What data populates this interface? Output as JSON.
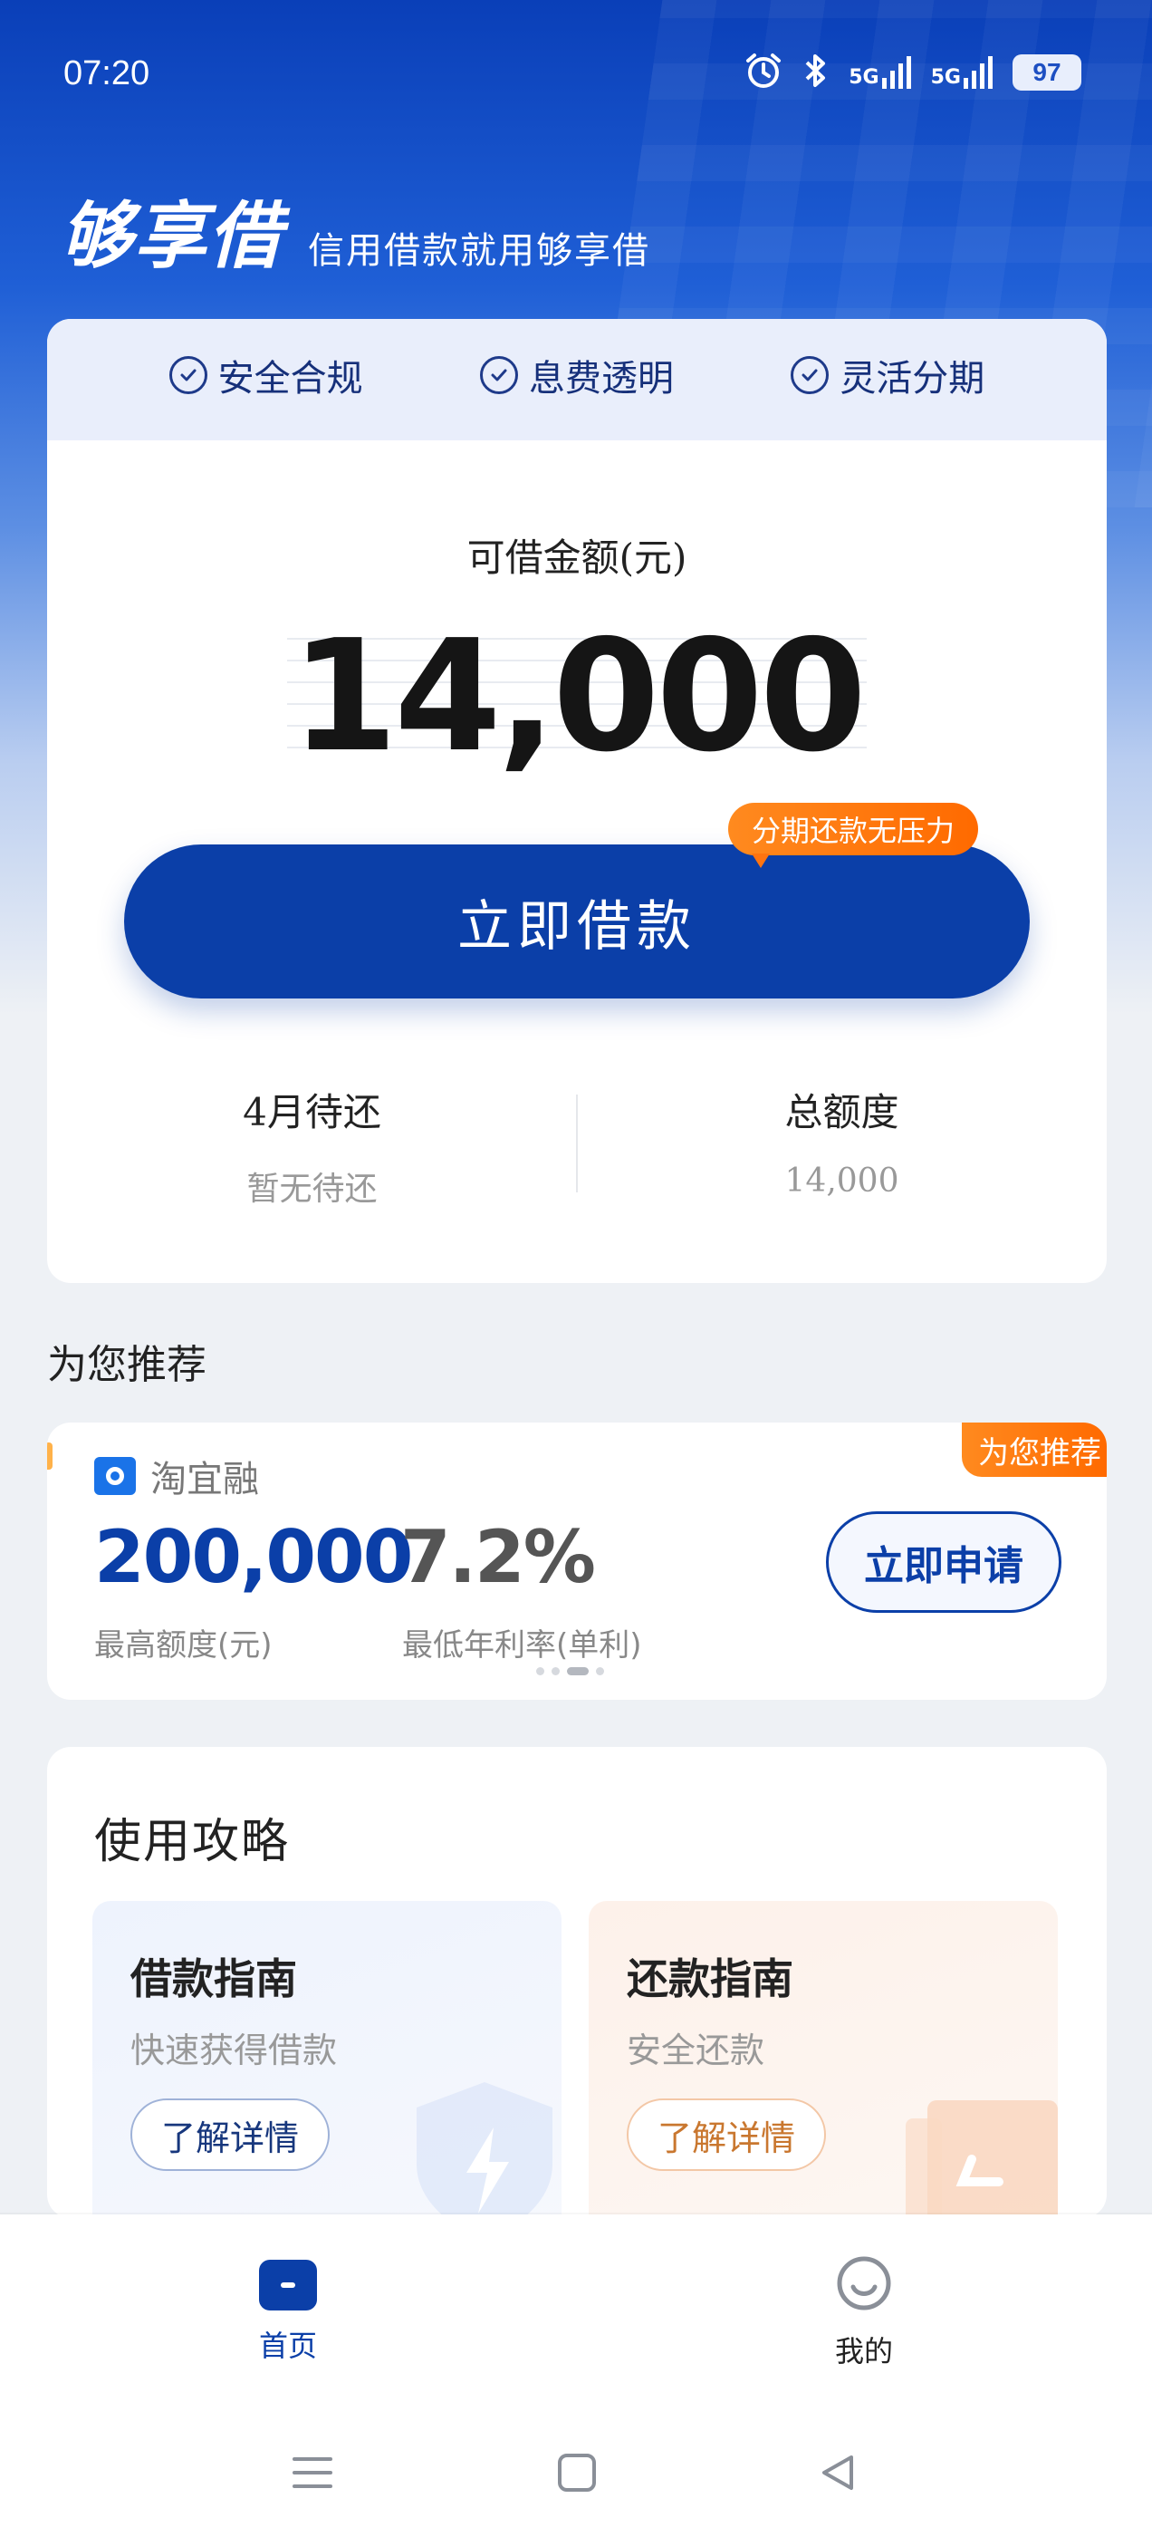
{
  "status_bar": {
    "time": "07:20",
    "signal_1": "5G",
    "signal_2": "5G",
    "battery": "97",
    "icons": [
      "alarm-icon",
      "bluetooth-icon",
      "signal-5g-icon",
      "signal-5g-icon",
      "battery-icon"
    ]
  },
  "brand": {
    "logo": "够享借",
    "slogan": "信用借款就用够享借"
  },
  "features": [
    {
      "label": "安全合规",
      "icon": "check-circle-icon"
    },
    {
      "label": "息费透明",
      "icon": "check-circle-icon"
    },
    {
      "label": "灵活分期",
      "icon": "check-circle-icon"
    }
  ],
  "amount": {
    "label": "可借金额(元)",
    "value": "14,000"
  },
  "borrow": {
    "button_label": "立即借款",
    "promo_tag": "分期还款无压力"
  },
  "stats": {
    "due_title": "4月待还",
    "due_value": "暂无待还",
    "total_title": "总额度",
    "total_value": "14,000"
  },
  "recommend": {
    "section_title": "为您推荐",
    "flag": "为您推荐",
    "brand_name": "淘宜融",
    "max_amount": "200,000",
    "max_amount_label": "最高额度(元)",
    "min_rate": "7.2%",
    "min_rate_label": "最低年利率(单利)",
    "button_label": "立即申请",
    "carousel_active_index": 2,
    "carousel_count": 4
  },
  "guide": {
    "title": "使用攻略",
    "borrow": {
      "title": "借款指南",
      "subtitle": "快速获得借款",
      "button_label": "了解详情"
    },
    "repay": {
      "title": "还款指南",
      "subtitle": "安全还款",
      "button_label": "了解详情"
    }
  },
  "tab_bar": {
    "home_label": "首页",
    "mine_label": "我的",
    "active": "home"
  },
  "colors": {
    "primary": "#0b3fa8",
    "accent_orange": "#ff7410",
    "header_blue": "#0a3fb8"
  }
}
